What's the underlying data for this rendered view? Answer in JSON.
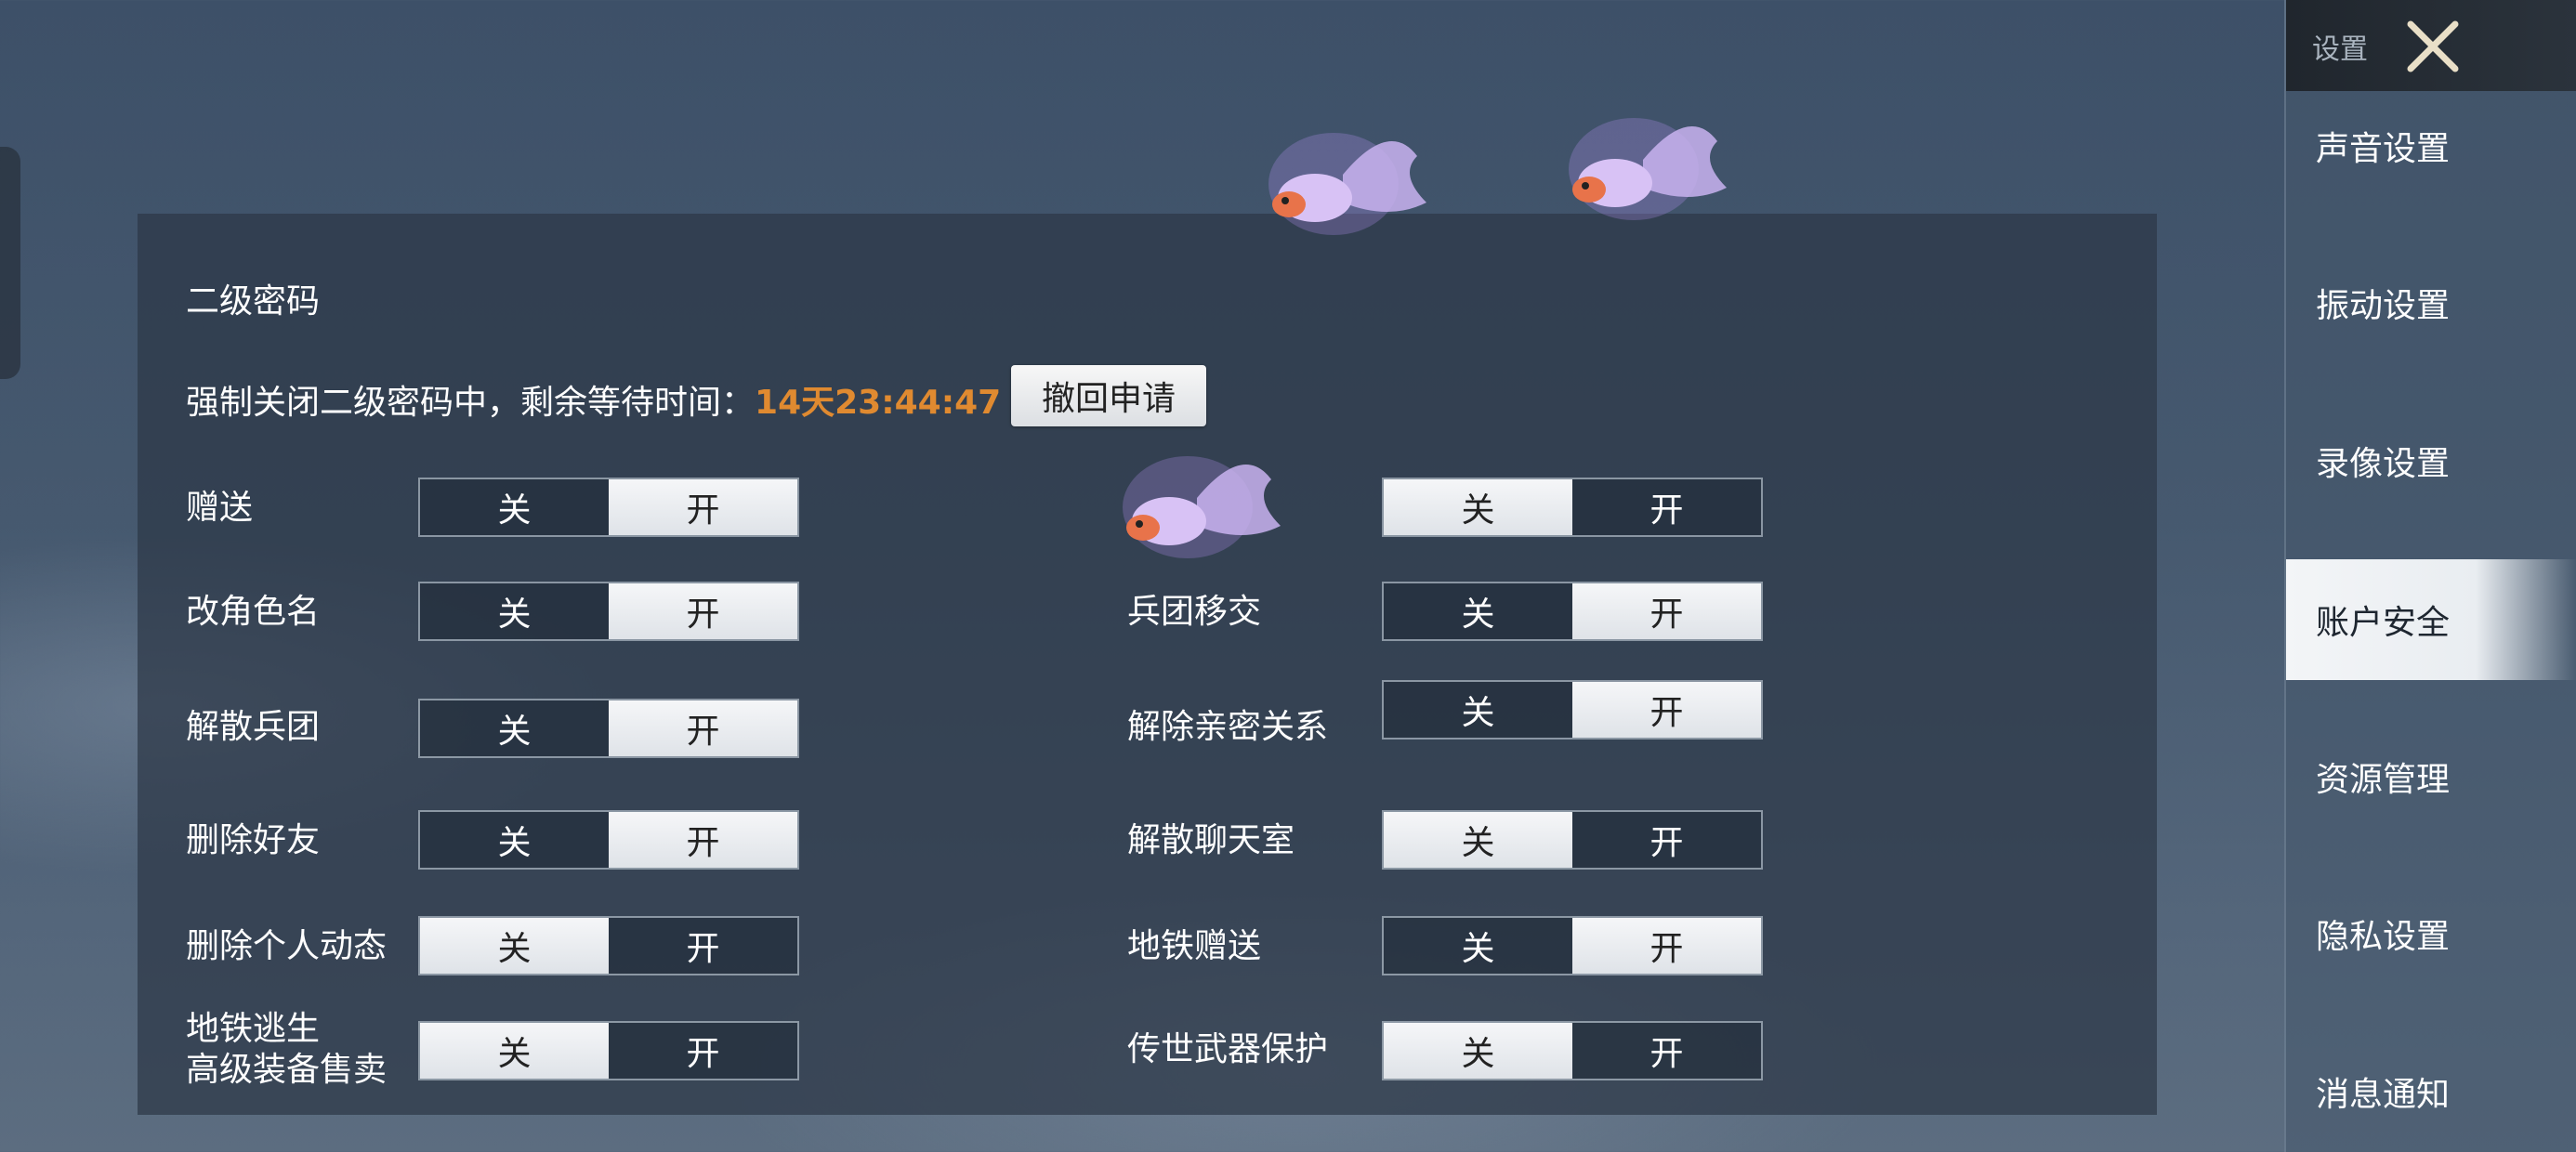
{
  "panel": {
    "title": "二级密码",
    "notice_prefix": "强制关闭二级密码中，剩余等待时间：",
    "countdown": "14天23:44:47",
    "revoke_button": "撤回申请",
    "off_label": "关",
    "on_label": "开",
    "left_rows": [
      {
        "label": "赠送",
        "state": "on"
      },
      {
        "label": "改角色名",
        "state": "on"
      },
      {
        "label": "解散兵团",
        "state": "on"
      },
      {
        "label": "删除好友",
        "state": "on"
      },
      {
        "label": "删除个人动态",
        "state": "off"
      },
      {
        "label_line1": "地铁逃生",
        "label_line2": "高级装备售卖",
        "state": "off"
      }
    ],
    "right_rows": [
      {
        "label": "",
        "state": "off"
      },
      {
        "label": "兵团移交",
        "state": "on"
      },
      {
        "label": "解除亲密关系",
        "state": "on"
      },
      {
        "label": "解散聊天室",
        "state": "off"
      },
      {
        "label": "地铁赠送",
        "state": "on"
      },
      {
        "label": "传世武器保护",
        "state": "off"
      }
    ]
  },
  "sidebar": {
    "title": "设置",
    "items": [
      {
        "label": "声音设置",
        "active": false
      },
      {
        "label": "振动设置",
        "active": false
      },
      {
        "label": "录像设置",
        "active": false
      },
      {
        "label": "账户安全",
        "active": true
      },
      {
        "label": "资源管理",
        "active": false
      },
      {
        "label": "隐私设置",
        "active": false
      },
      {
        "label": "消息通知",
        "active": false
      }
    ]
  },
  "colors": {
    "countdown": "#e08a30",
    "active_nav_bg": "#f3f5f7",
    "toggle_active_bg": "#f5f6f8"
  },
  "icons": [
    "close-icon",
    "goldfish-decoration-icon"
  ]
}
